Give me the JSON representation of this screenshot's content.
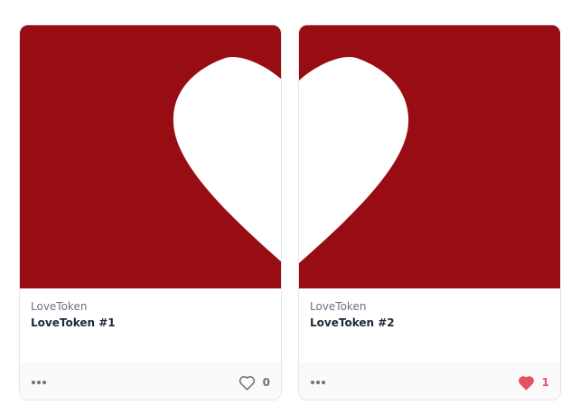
{
  "colors": {
    "artwork_background": "#970d13",
    "heart_fill": "#ffffff",
    "liked_heart": "#e5525f",
    "unliked_heart": "#6b7280"
  },
  "cards": [
    {
      "collection": "LoveToken",
      "name": "LoveToken #1",
      "artwork": "left-half-heart",
      "likes": "0",
      "liked": false,
      "like_icon": "heart-outline-icon",
      "menu_icon": "more-horizontal-icon"
    },
    {
      "collection": "LoveToken",
      "name": "LoveToken #2",
      "artwork": "right-half-heart",
      "likes": "1",
      "liked": true,
      "like_icon": "heart-filled-icon",
      "menu_icon": "more-horizontal-icon"
    }
  ]
}
